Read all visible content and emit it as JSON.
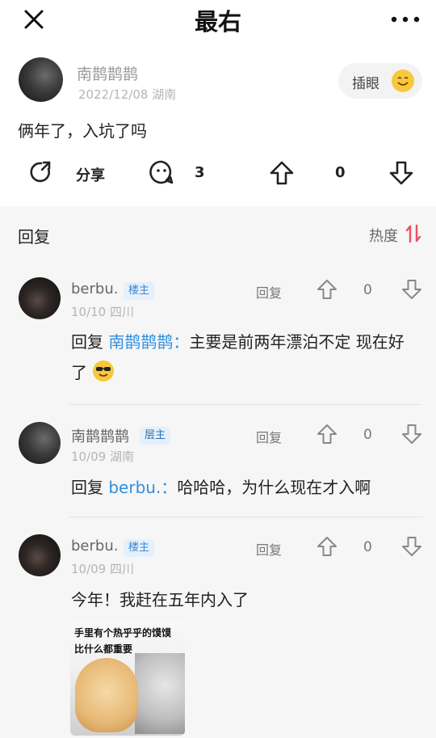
{
  "topbar": {
    "title": "最右"
  },
  "post": {
    "author": "南鹊鹊鹊",
    "meta": "2022/12/08 湖南",
    "chip_label": "插眼",
    "content": "俩年了，入坑了吗",
    "share_label": "分享",
    "comment_count": "3",
    "vote_count": "0"
  },
  "comments_header": {
    "label": "回复",
    "sort_label": "热度"
  },
  "comments": [
    {
      "name": "berbu.",
      "badge": "楼主",
      "meta": "10/10 四川",
      "reply_label": "回复",
      "count": "0",
      "prefix": "回复 ",
      "mention": "南鹊鹊鹊：",
      "text": "主要是前两年漂泊不定 现在好了"
    },
    {
      "name": "南鹊鹊鹊",
      "badge": "层主",
      "meta": "10/09 湖南",
      "reply_label": "回复",
      "count": "0",
      "prefix": "回复 ",
      "mention": "berbu.：",
      "text": "哈哈哈，为什么现在才入啊"
    },
    {
      "name": "berbu.",
      "badge": "楼主",
      "meta": "10/09 四川",
      "reply_label": "回复",
      "count": "0",
      "text": "今年！我赶在五年内入了"
    }
  ],
  "meme": {
    "caption_line1": "手里有个热乎乎的馍馍",
    "caption_line2": "比什么都重要"
  },
  "colors": {
    "accent": "#2f8fe0",
    "sort_accent": "#f04d64",
    "emoji_yellow": "#f7c83b"
  }
}
